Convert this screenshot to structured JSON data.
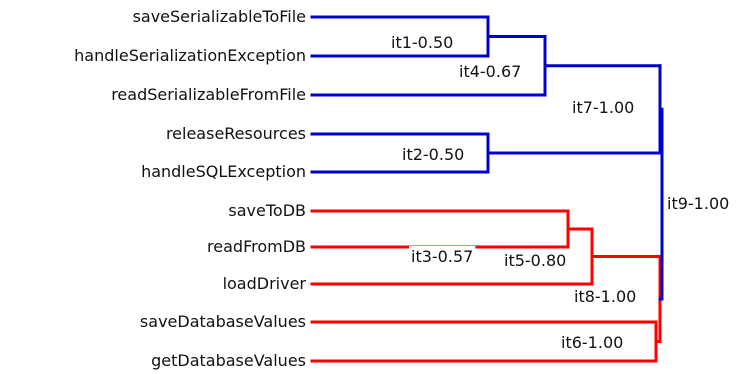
{
  "leaves": [
    "saveSerializableToFile",
    "handleSerializationException",
    "readSerializableFromFile",
    "releaseResources",
    "handleSQLException",
    "saveToDB",
    "readFromDB",
    "loadDriver",
    "saveDatabaseValues",
    "getDatabaseValues"
  ],
  "merges": [
    {
      "label": "it1-0.50",
      "children": [
        "leaf:0",
        "leaf:1"
      ],
      "color": "#0000cc"
    },
    {
      "label": "it2-0.50",
      "children": [
        "leaf:3",
        "leaf:4"
      ],
      "color": "#0000cc"
    },
    {
      "label": "it3-0.57",
      "children": [
        "leaf:5",
        "leaf:6"
      ],
      "color": "#ff0000"
    },
    {
      "label": "it4-0.67",
      "children": [
        "merge:0",
        "leaf:2"
      ],
      "color": "#0000cc"
    },
    {
      "label": "it5-0.80",
      "children": [
        "merge:2",
        "leaf:7"
      ],
      "color": "#ff0000"
    },
    {
      "label": "it6-1.00",
      "children": [
        "leaf:8",
        "leaf:9"
      ],
      "color": "#ff0000"
    },
    {
      "label": "it7-1.00",
      "children": [
        "merge:3",
        "merge:1"
      ],
      "color": "#0000cc"
    },
    {
      "label": "it8-1.00",
      "children": [
        "merge:4",
        "merge:5"
      ],
      "color": "#ff0000"
    },
    {
      "label": "it9-1.00",
      "children": [
        "merge:6",
        "merge:7"
      ],
      "color": "#0000cc"
    }
  ],
  "colors": {
    "blue_cluster": "#0000cc",
    "red_cluster": "#ff0000",
    "label_text": "#111111"
  }
}
